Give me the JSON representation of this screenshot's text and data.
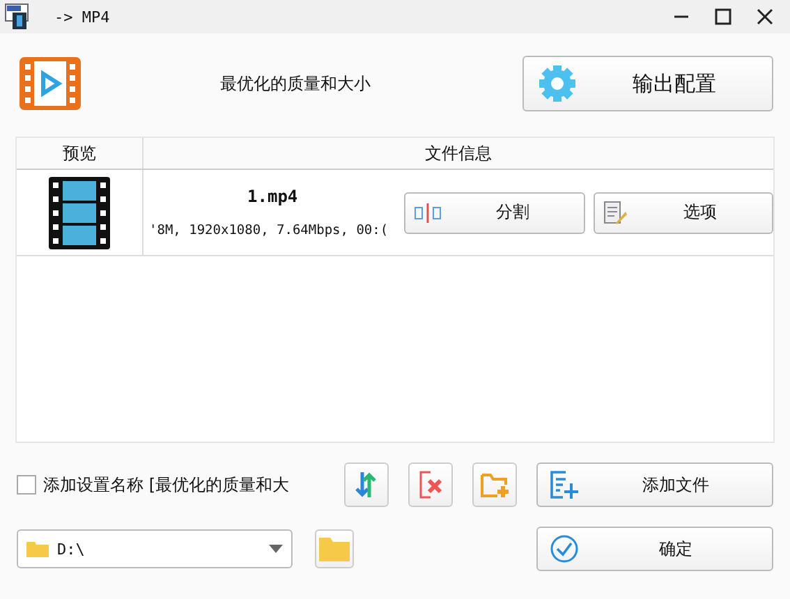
{
  "window": {
    "title": "-> MP4"
  },
  "header": {
    "preset": "最优化的质量和大小",
    "config_button": "输出配置"
  },
  "table": {
    "columns": [
      "预览",
      "文件信息"
    ],
    "rows": [
      {
        "filename": "1.mp4",
        "details": "'8M, 1920x1080, 7.64Mbps, 00:(",
        "split_button": "分割",
        "options_button": "选项"
      }
    ]
  },
  "add_name": {
    "label": "添加设置名称 [最优化的质量和大",
    "checked": false
  },
  "add_file_button": "添加文件",
  "output_folder": {
    "value": "D:\\"
  },
  "ok_button": "确定"
}
